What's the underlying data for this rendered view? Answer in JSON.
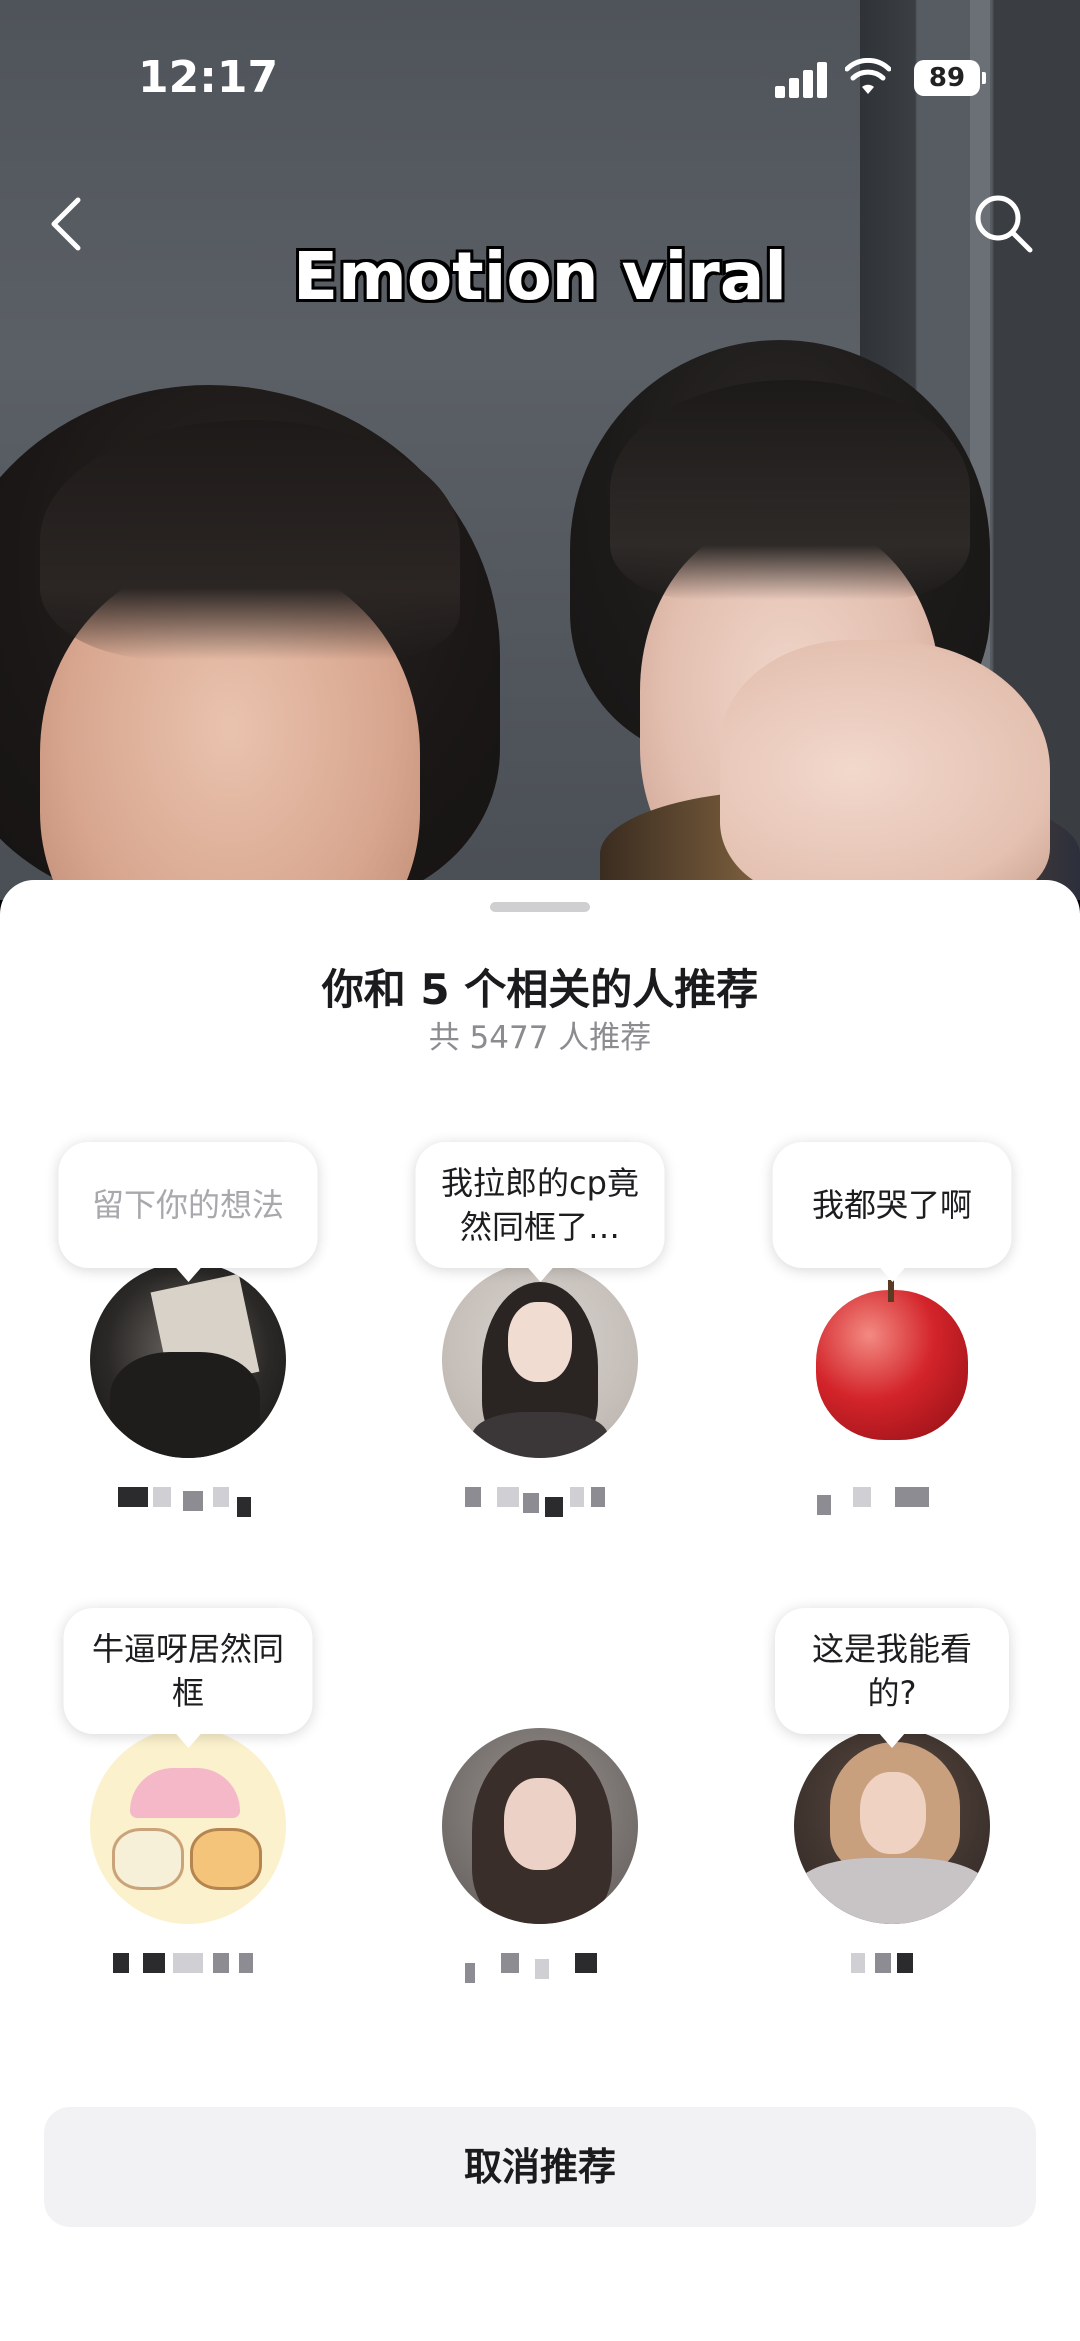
{
  "status_bar": {
    "time": "12:17",
    "battery": "89"
  },
  "header": {
    "video_title": "Emotion viral"
  },
  "sheet": {
    "title": "你和 5 个相关的人推荐",
    "subtitle": "共 5477 人推荐",
    "users": [
      {
        "comment": "留下你的想法",
        "placeholder": true,
        "avatar": "dark-photo-avatar"
      },
      {
        "comment": "我拉郎的cp竟然同框了…",
        "placeholder": false,
        "avatar": "girl-portrait-avatar"
      },
      {
        "comment": "我都哭了啊",
        "placeholder": false,
        "avatar": "apple-avatar"
      },
      {
        "comment": "牛逼呀居然同框",
        "placeholder": false,
        "avatar": "cartoon-avatar"
      },
      {
        "comment": "",
        "placeholder": false,
        "avatar": "girl-selfie-avatar"
      },
      {
        "comment": "这是我能看的?",
        "placeholder": false,
        "avatar": "blonde-avatar"
      }
    ],
    "cancel_label": "取消推荐"
  },
  "colors": {
    "sheet_bg": "#ffffff",
    "button_bg": "#f2f2f5",
    "subtitle": "#8b8b90"
  }
}
